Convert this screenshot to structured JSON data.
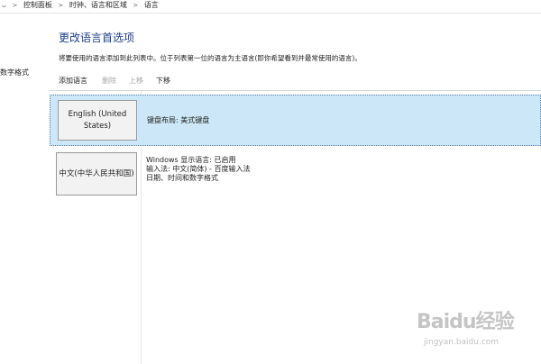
{
  "breadcrumb": {
    "prefix": "ᴗ",
    "items": [
      "控制面板",
      "时钟、语言和区域",
      "语言"
    ]
  },
  "left_pane": {
    "link_label": "数字格式"
  },
  "main": {
    "title": "更改语言首选项",
    "description": "将要使用的语言添加到此列表中。位于列表第一位的语言为主语言(即你希望看到并最常使用的语言)。"
  },
  "toolbar": {
    "add": "添加语言",
    "remove": "删除",
    "move_up": "上移",
    "move_down": "下移"
  },
  "languages": [
    {
      "name": "English (United States)",
      "details": [
        "键盘布局: 美式键盘"
      ],
      "selected": true
    },
    {
      "name": "中文(中华人民共和国)",
      "details": [
        "Windows 显示语言: 已启用",
        "输入法: 中文(简体) - 百度输入法",
        "日期、时间和数字格式"
      ],
      "selected": false
    }
  ],
  "watermark": {
    "text": "Baidu经验",
    "url": "jingyan.baidu.com"
  },
  "colors": {
    "title": "#1e3f8a",
    "selection": "#cce8f8",
    "disabled": "#a8a8a8"
  }
}
